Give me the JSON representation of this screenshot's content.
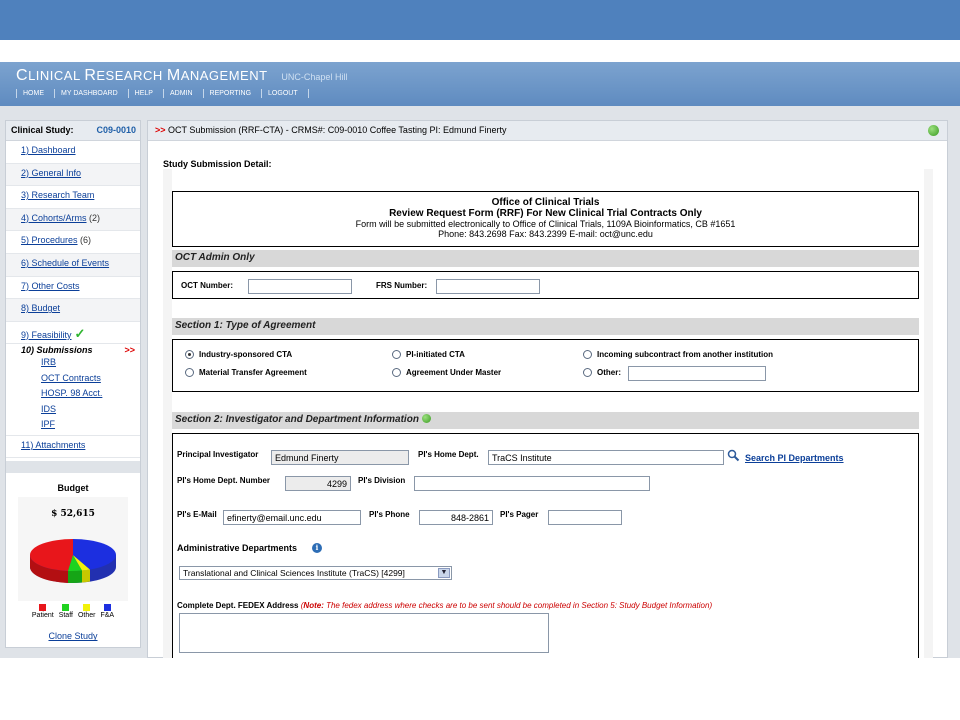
{
  "app": {
    "brand_c": "C",
    "brand_linical": "LINICAL ",
    "brand_r": "R",
    "brand_esearch": "ESEARCH ",
    "brand_m": "M",
    "brand_anagement": "ANAGEMENT",
    "subtitle": "UNC-Chapel Hill"
  },
  "topnav": [
    "HOME",
    "MY DASHBOARD",
    "HELP",
    "ADMIN",
    "REPORTING",
    "LOGOUT"
  ],
  "sidebar": {
    "study_label": "Clinical Study:",
    "study_id": "C09-0010",
    "items": [
      {
        "label": "1) Dashboard",
        "count": ""
      },
      {
        "label": "2) General Info",
        "count": ""
      },
      {
        "label": "3) Research Team",
        "count": ""
      },
      {
        "label": "4) Cohorts/Arms",
        "count": "(2)"
      },
      {
        "label": "5) Procedures",
        "count": "(6)"
      },
      {
        "label": "6) Schedule of Events",
        "count": ""
      },
      {
        "label": "7) Other Costs",
        "count": ""
      },
      {
        "label": "8) Budget",
        "count": ""
      },
      {
        "label": "9) Feasibility",
        "count": ""
      }
    ],
    "check_mark": "✓",
    "submissions_label": "10) Submissions",
    "submissions_arrow": ">>",
    "submissions": [
      "IRB",
      "OCT Contracts",
      "HOSP. 98 Acct.",
      "IDS",
      "IPF"
    ],
    "attachments_label": "11) Attachments",
    "budget_title": "Budget",
    "budget_amount": "$ 52,615",
    "legend": [
      {
        "label": "Patient",
        "color": "#e8161b"
      },
      {
        "label": "Staff",
        "color": "#1fd31f"
      },
      {
        "label": "Other",
        "color": "#f2f20a"
      },
      {
        "label": "F&A",
        "color": "#1c2fe0"
      }
    ],
    "clone_label": "Clone Study"
  },
  "main": {
    "head_arrows": ">>",
    "head_text": "OCT Submission (RRF-CTA) - CRMS#: C09-0010 Coffee Tasting PI: Edmund Finerty",
    "detail_title": "Study Submission Detail:",
    "oct_box": {
      "line1": "Office of Clinical Trials",
      "line2": "Review Request Form (RRF) For New Clinical Trial Contracts Only",
      "line3": "Form will be submitted electronically to Office of Clinical Trials, 1109A Bioinformatics, CB #1651",
      "line4": "Phone: 843.2698     Fax: 843.2399     E-mail: oct@unc.edu"
    },
    "admin": {
      "title": "OCT Admin Only",
      "oct_number_label": "OCT Number:",
      "oct_number_value": "",
      "frs_number_label": "FRS Number:",
      "frs_number_value": ""
    },
    "section1": {
      "title": "Section 1: Type of Agreement",
      "options": [
        {
          "label": "Industry-sponsored CTA",
          "selected": true
        },
        {
          "label": "PI-initiated CTA",
          "selected": false
        },
        {
          "label": "Incoming subcontract from another institution",
          "selected": false
        },
        {
          "label": "Material Transfer Agreement",
          "selected": false
        },
        {
          "label": "Agreement Under Master",
          "selected": false
        },
        {
          "label": "Other:",
          "selected": false
        }
      ],
      "other_value": ""
    },
    "section2": {
      "title": "Section 2: Investigator and Department Information",
      "pi_label": "Principal Investigator",
      "pi_value": "Edmund Finerty",
      "home_dept_label": "PI's Home Dept.",
      "home_dept_value": "TraCS Institute",
      "search_link": "Search PI Departments",
      "dept_number_label": "PI's Home Dept. Number",
      "dept_number_value": "4299",
      "division_label": "PI's Division",
      "division_value": "",
      "email_label": "PI's E-Mail",
      "email_value": "efinerty@email.unc.edu",
      "phone_label": "PI's Phone",
      "phone_value": "848-2861",
      "pager_label": "PI's Pager",
      "pager_value": "",
      "admin_depts_label": "Administrative Departments",
      "admin_dept_selected": "Translational and Clinical Sciences Institute (TraCS) [4299]",
      "fedex_label": "Complete Dept. FEDEX Address",
      "fedex_note_open": "(",
      "fedex_note_label": "Note:",
      "fedex_note_text": " The fedex address where checks are to be sent should be completed in Section 5: Study Budget Information",
      "fedex_note_close": ")",
      "fedex_value": ""
    }
  }
}
